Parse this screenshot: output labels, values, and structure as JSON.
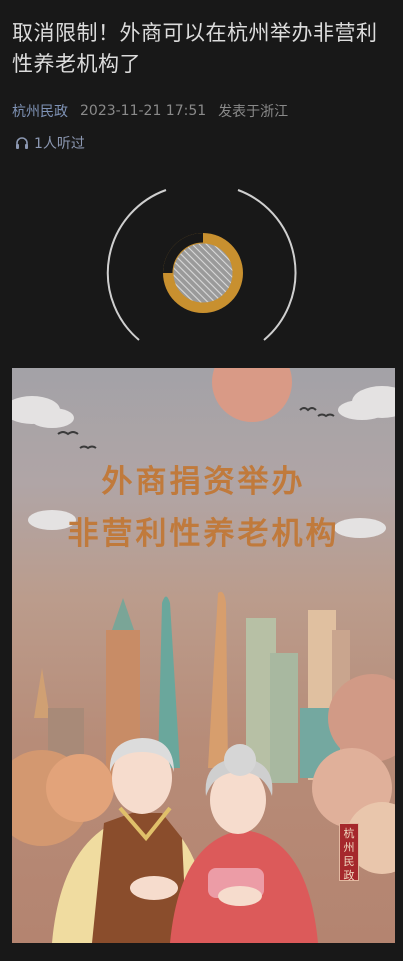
{
  "article": {
    "title": "取消限制！外商可以在杭州举办非营利性养老机构了",
    "author": "杭州民政",
    "timestamp": "2023-11-21 17:51",
    "location": "发表于浙江",
    "listen_count": "1人听过"
  },
  "player": {
    "state": "loading",
    "icon": "audio-progress-disc-icon"
  },
  "poster": {
    "title_line1": "外商捐资举办",
    "title_line2": "非营利性养老机构",
    "seal_text": "杭州民政"
  },
  "colors": {
    "background": "#181818",
    "author_link": "#7f93b6",
    "poster_title": "#c07a3c",
    "player_ring": "#c8902f"
  }
}
